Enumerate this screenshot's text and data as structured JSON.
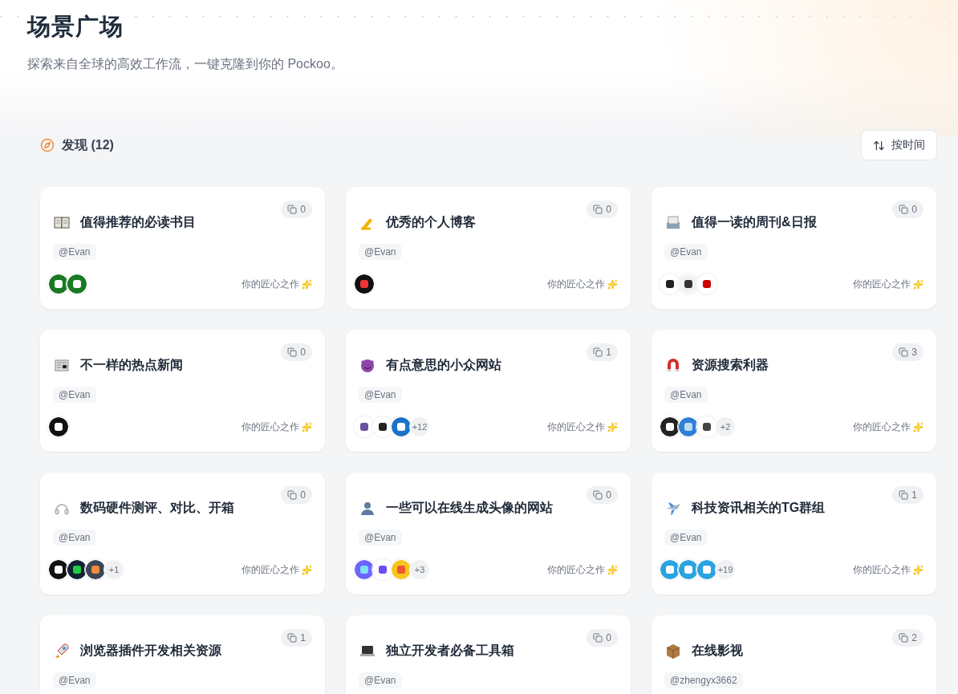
{
  "header": {
    "title": "场景广场",
    "subtitle": "探索来自全球的高效工作流，一键克隆到你的 Pockoo。"
  },
  "section": {
    "title": "发现 (12)",
    "sort_button": "按时间"
  },
  "cards": [
    {
      "title": "值得推荐的必读书目",
      "copies": "0",
      "author": "@Evan",
      "footer": "你的匠心之作"
    },
    {
      "title": "优秀的个人博客",
      "copies": "0",
      "author": "@Evan",
      "footer": "你的匠心之作"
    },
    {
      "title": "值得一读的周刊&日报",
      "copies": "0",
      "author": "@Evan",
      "footer": "你的匠心之作"
    },
    {
      "title": "不一样的热点新闻",
      "copies": "0",
      "author": "@Evan",
      "footer": "你的匠心之作"
    },
    {
      "title": "有点意思的小众网站",
      "copies": "1",
      "author": "@Evan",
      "more": "+12",
      "footer": "你的匠心之作"
    },
    {
      "title": "资源搜索利器",
      "copies": "3",
      "author": "@Evan",
      "more": "+2",
      "footer": "你的匠心之作"
    },
    {
      "title": "数码硬件测评、对比、开箱",
      "copies": "0",
      "author": "@Evan",
      "more": "+1",
      "footer": "你的匠心之作"
    },
    {
      "title": "一些可以在线生成头像的网站",
      "copies": "0",
      "author": "@Evan",
      "more": "+3",
      "footer": "你的匠心之作"
    },
    {
      "title": "科技资讯相关的TG群组",
      "copies": "1",
      "author": "@Evan",
      "more": "+19",
      "footer": "你的匠心之作"
    },
    {
      "title": "浏览器插件开发相关资源",
      "copies": "1",
      "author": "@Evan"
    },
    {
      "title": "独立开发者必备工具箱",
      "copies": "0",
      "author": "@Evan"
    },
    {
      "title": "在线影视",
      "copies": "2",
      "author": "@zhengyx3662"
    }
  ]
}
